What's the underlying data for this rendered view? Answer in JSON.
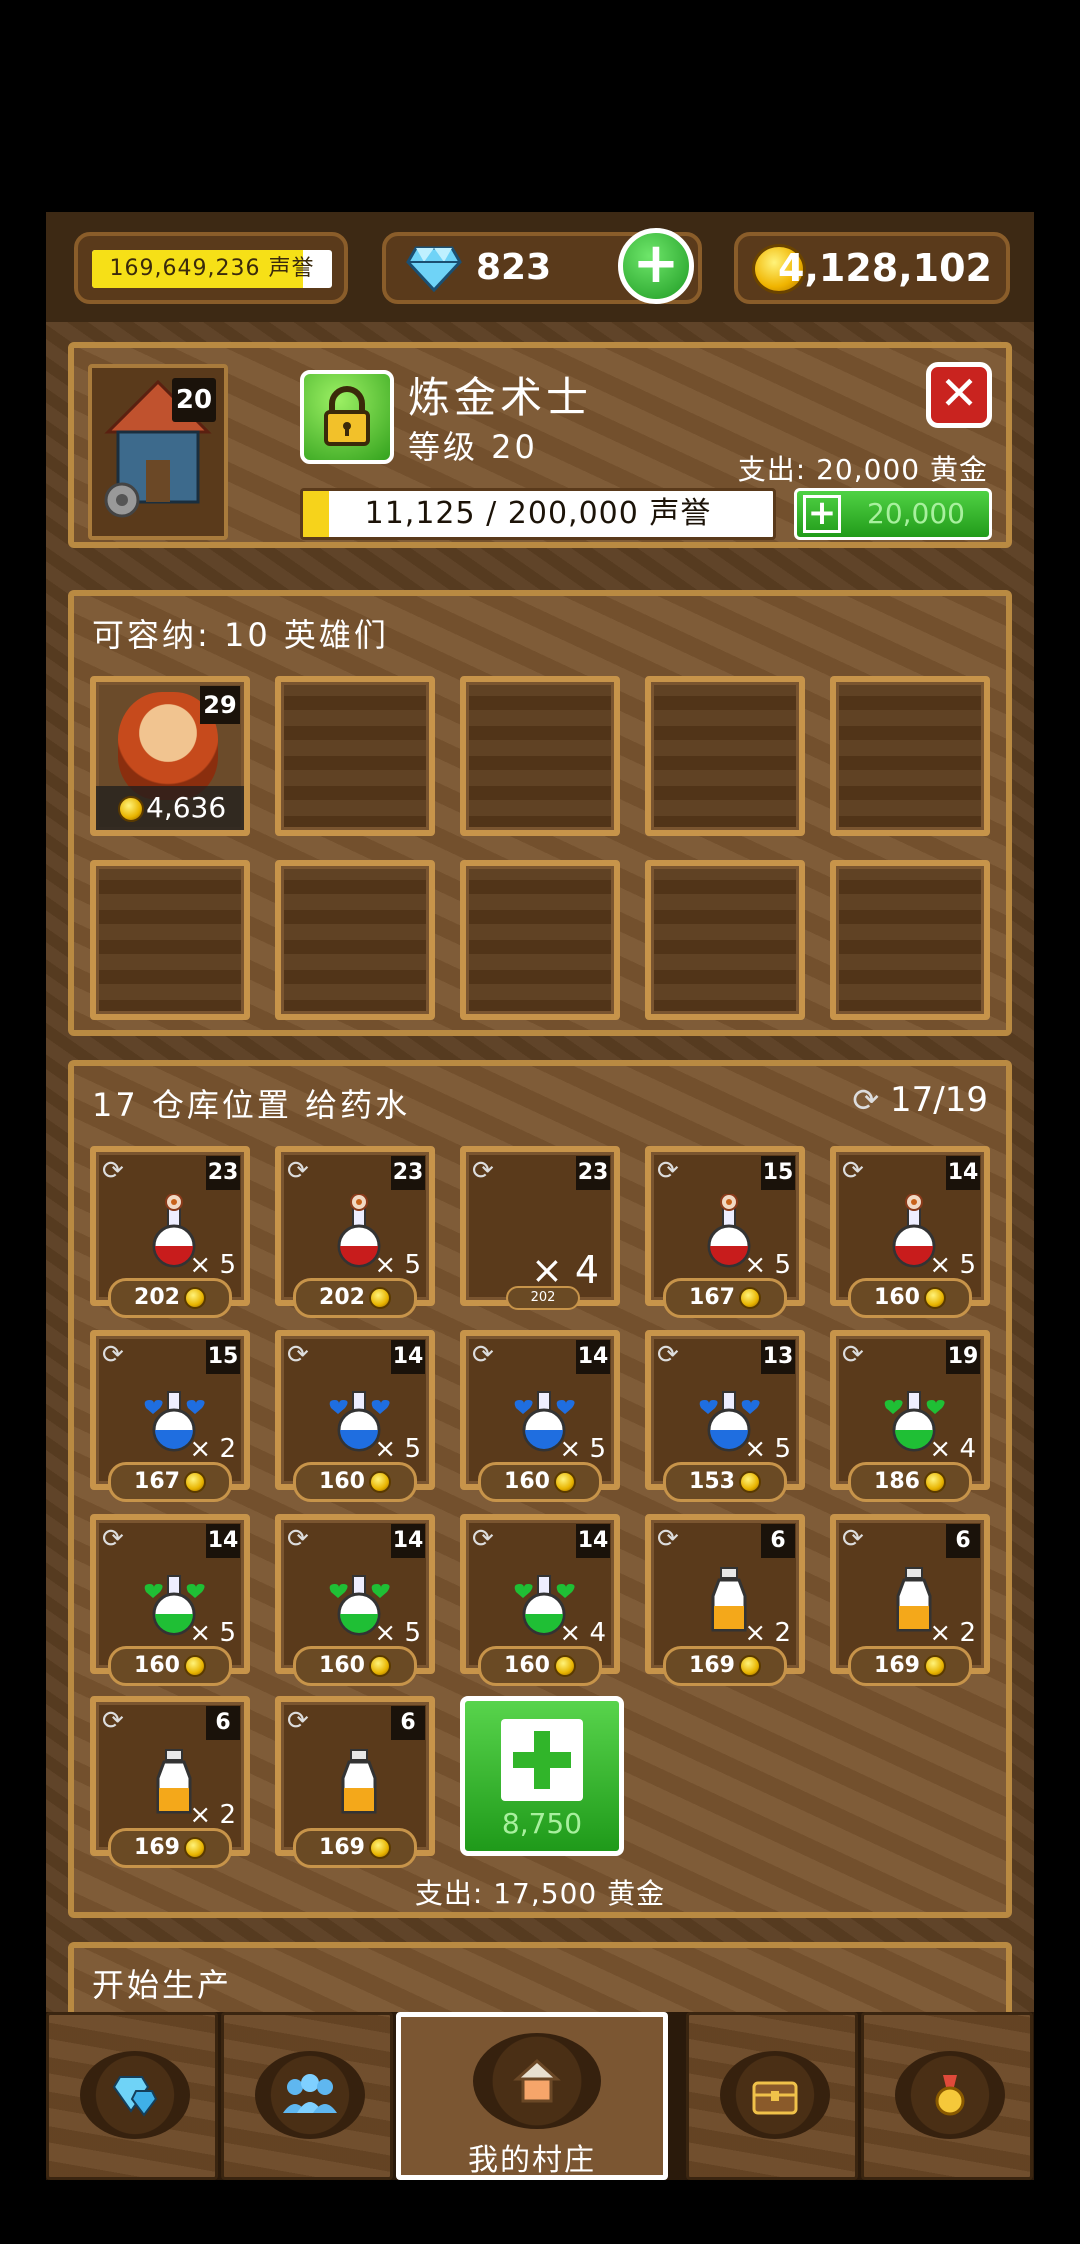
{
  "top_bar": {
    "reputation": "169,649,236 声誉",
    "reputation_fill_fraction": 0.88,
    "gems": "823",
    "gold": "4,128,102"
  },
  "building": {
    "level_badge": "20",
    "name": "炼金术士",
    "level_text": "等级 20",
    "upgrade_cost": "支出: 20,000 黄金",
    "progress_text": "11,125 / 200,000 声誉",
    "progress_fraction": 0.056,
    "gem_button": "20,000"
  },
  "heroes": {
    "title": "可容纳: 10 英雄们",
    "hero_level": "29",
    "hero_price": "4,636"
  },
  "potions": {
    "title": "17 仓库位置 给药水",
    "count": "17/19",
    "slots": [
      {
        "level": "23",
        "qty": "× 5",
        "price": "202",
        "color": "#c81c1c",
        "kind": "flower"
      },
      {
        "level": "23",
        "qty": "× 5",
        "price": "202",
        "color": "#c81c1c",
        "kind": "flower"
      },
      {
        "level": "23",
        "qty": "× 4",
        "price": "202",
        "color": "#c81c1c",
        "kind": "dragging"
      },
      {
        "level": "15",
        "qty": "× 5",
        "price": "167",
        "color": "#c81c1c",
        "kind": "flower"
      },
      {
        "level": "14",
        "qty": "× 5",
        "price": "160",
        "color": "#c81c1c",
        "kind": "flower"
      },
      {
        "level": "15",
        "qty": "× 2",
        "price": "167",
        "color": "#1f6ee0",
        "kind": "heart"
      },
      {
        "level": "14",
        "qty": "× 5",
        "price": "160",
        "color": "#1f6ee0",
        "kind": "heart"
      },
      {
        "level": "14",
        "qty": "× 5",
        "price": "160",
        "color": "#1f6ee0",
        "kind": "heart"
      },
      {
        "level": "13",
        "qty": "× 5",
        "price": "153",
        "color": "#1f6ee0",
        "kind": "heart"
      },
      {
        "level": "19",
        "qty": "× 4",
        "price": "186",
        "color": "#1fbf35",
        "kind": "heart"
      },
      {
        "level": "14",
        "qty": "× 5",
        "price": "160",
        "color": "#1fbf35",
        "kind": "heart"
      },
      {
        "level": "14",
        "qty": "× 5",
        "price": "160",
        "color": "#1fbf35",
        "kind": "heart"
      },
      {
        "level": "14",
        "qty": "× 4",
        "price": "160",
        "color": "#1fbf35",
        "kind": "heart"
      },
      {
        "level": "6",
        "qty": "× 2",
        "price": "169",
        "color": "#f4a81a",
        "kind": "bottle"
      },
      {
        "level": "6",
        "qty": "× 2",
        "price": "169",
        "color": "#f4a81a",
        "kind": "bottle"
      },
      {
        "level": "6",
        "qty": "× 2",
        "price": "169",
        "color": "#f4a81a",
        "kind": "bottle"
      },
      {
        "level": "6",
        "qty": "",
        "price": "169",
        "color": "#f4a81a",
        "kind": "bottle"
      }
    ],
    "add_slot_cost": "8,750",
    "expand_cost": "支出: 17,500 黄金"
  },
  "production": {
    "title": "开始生产"
  },
  "nav": {
    "village_label": "我的村庄"
  }
}
